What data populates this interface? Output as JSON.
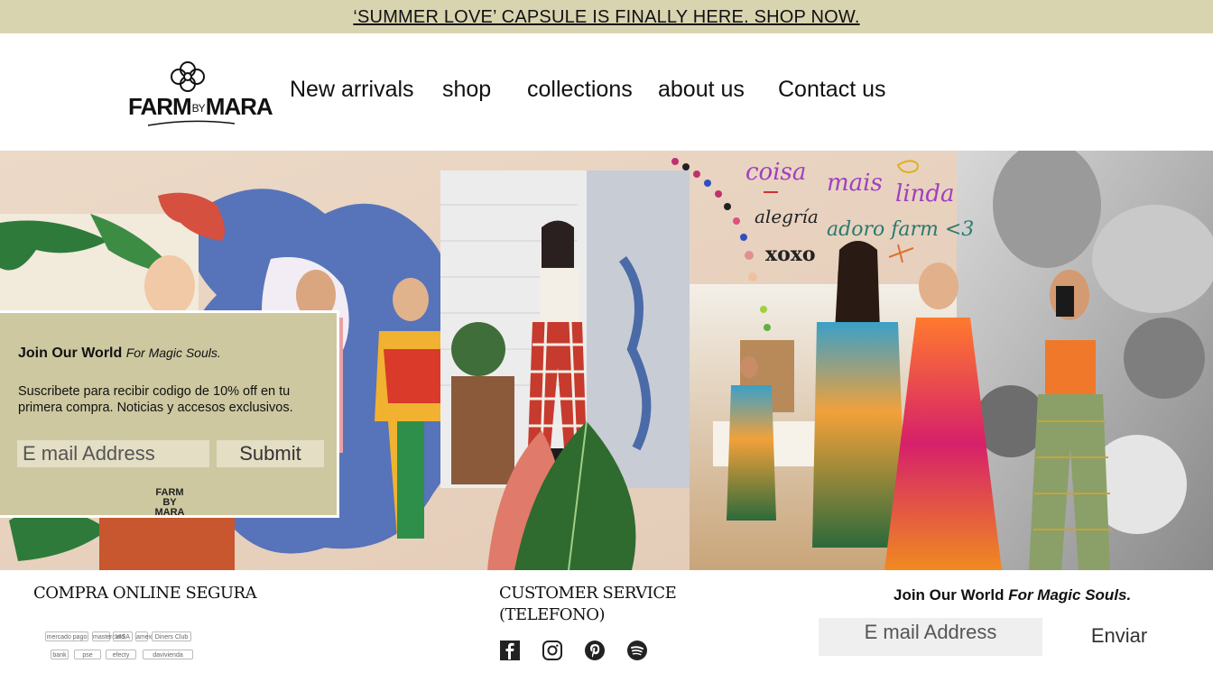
{
  "announcement": {
    "text": "‘SUMMER LOVE’ CAPSULE IS FINALLY HERE. SHOP NOW."
  },
  "brand": {
    "logo_main_left": "FARM",
    "logo_by": "BY",
    "logo_main_right": "MARA"
  },
  "nav": {
    "items": [
      {
        "label": "New arrivals"
      },
      {
        "label": "shop"
      },
      {
        "label": "collections"
      },
      {
        "label": "about us"
      },
      {
        "label": "Contact us"
      }
    ]
  },
  "hero": {
    "handwriting": {
      "line1_a": "coisa",
      "line1_b": "mais",
      "line1_c": "linda",
      "line2_a": "alegría",
      "line2_b": "adoro farm <3",
      "line3": "xoxo"
    }
  },
  "popup": {
    "title": "Join Our World",
    "title_italic": "For Magic Souls.",
    "text": "Suscribete para recibir codigo de 10% off en tu primera compra. Noticias y accesos exclusivos.",
    "email_placeholder": "E mail Address",
    "submit_label": "Submit",
    "logo_top": "FARM BY",
    "logo_bottom": "MARA"
  },
  "footer": {
    "secure_heading": "COMPRA ONLINE SEGURA",
    "payment_methods": [
      "mercado pago",
      "mastercard",
      "VISA",
      "amex",
      "Diners Club",
      "bank",
      "pse",
      "efecty",
      "davivienda"
    ],
    "service_heading_line1": "CUSTOMER SERVICE",
    "service_heading_line2": "(TELEFONO)",
    "social": [
      {
        "icon": "facebook-icon"
      },
      {
        "icon": "instagram-icon"
      },
      {
        "icon": "pinterest-icon"
      },
      {
        "icon": "spotify-icon"
      }
    ],
    "join_title": "Join Our World",
    "join_italic": "For Magic Souls.",
    "email_placeholder": "E mail Address",
    "send_label": "Enviar"
  },
  "colors": {
    "announcement_bg": "#d9d4b0",
    "popup_bg": "#cdc8a0",
    "field_bg": "#e3dec4",
    "footer_field_bg": "#efefef",
    "handwriting_purple": "#a040c0",
    "handwriting_orange": "#e07030"
  }
}
